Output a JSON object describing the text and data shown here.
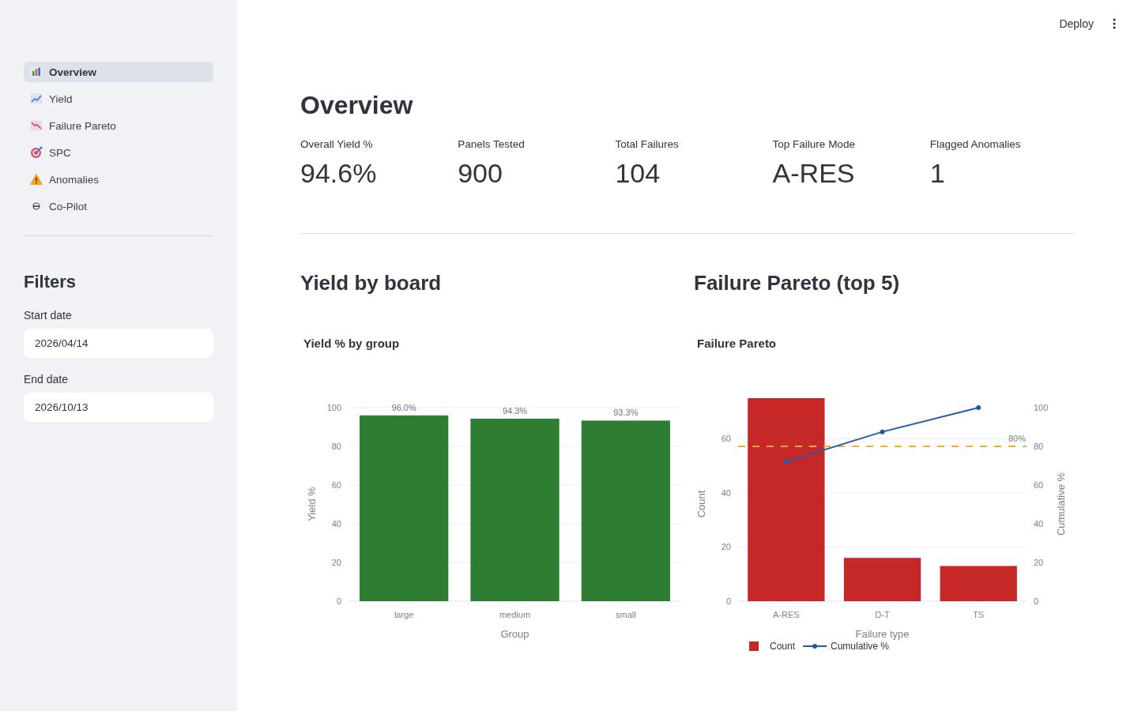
{
  "header": {
    "deploy_label": "Deploy"
  },
  "sidebar": {
    "nav": [
      {
        "label": "Overview",
        "selected": true
      },
      {
        "label": "Yield",
        "selected": false
      },
      {
        "label": "Failure Pareto",
        "selected": false
      },
      {
        "label": "SPC",
        "selected": false
      },
      {
        "label": "Anomalies",
        "selected": false
      },
      {
        "label": "Co-Pilot",
        "selected": false
      }
    ],
    "filters": {
      "title": "Filters",
      "fields": [
        {
          "label": "Start date",
          "value": "2026/04/14"
        },
        {
          "label": "End date",
          "value": "2026/10/13"
        }
      ]
    }
  },
  "page": {
    "title": "Overview",
    "metrics": [
      {
        "label": "Overall Yield %",
        "value": "94.6%"
      },
      {
        "label": "Panels Tested",
        "value": "900"
      },
      {
        "label": "Total Failures",
        "value": "104"
      },
      {
        "label": "Top Failure Mode",
        "value": "A-RES"
      },
      {
        "label": "Flagged Anomalies",
        "value": "1"
      }
    ],
    "sections": [
      {
        "title": "Yield by board",
        "chart_data": {
          "type": "bar",
          "title": "Yield % by group",
          "xlabel": "Group",
          "ylabel": "Yield %",
          "categories": [
            "large",
            "medium",
            "small"
          ],
          "series": [
            {
              "color": "#2e7d32",
              "values": [
                96.0,
                94.3,
                93.3
              ]
            }
          ],
          "ylim": [
            0,
            100
          ],
          "yticks": [
            0,
            20,
            40,
            60,
            80,
            100
          ],
          "grid": true,
          "value_labels": [
            "96.0%",
            "94.3%",
            "93.3%"
          ]
        }
      },
      {
        "title": "Failure Pareto (top 5)",
        "chart_data": {
          "type": "bar",
          "title": "Failure Pareto",
          "xlabel": "Failure type",
          "ylabel": "Count",
          "y2label": "Cumulative %",
          "categories": [
            "A-RES",
            "D-T",
            "TS"
          ],
          "series": [
            {
              "name": "Count",
              "color": "#c62828",
              "values": [
                75,
                16,
                13
              ]
            },
            {
              "name": "Cumulative %",
              "type": "line",
              "axis": "y2",
              "marker": true,
              "color": "#1f5ba8",
              "values": [
                72.1,
                87.5,
                100
              ]
            }
          ],
          "ylim": [
            0,
            75
          ],
          "yticks": [
            0,
            20,
            40,
            60
          ],
          "y2lim": [
            0,
            100
          ],
          "y2ticks": [
            0,
            20,
            40,
            60,
            80,
            100
          ],
          "grid": true,
          "legend": "bottom",
          "ref_lines": [
            {
              "axis": "y2",
              "value": 80,
              "label": "80%",
              "color": "#f0ad3c"
            }
          ]
        }
      }
    ]
  }
}
